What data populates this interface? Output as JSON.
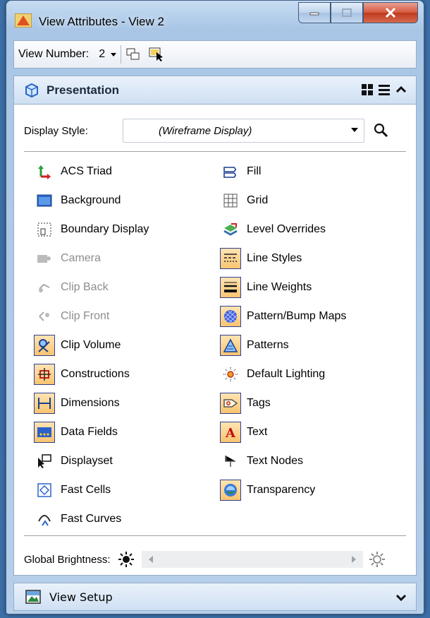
{
  "window": {
    "title": "View Attributes - View 2"
  },
  "toolbar": {
    "view_number_label": "View Number:",
    "view_number_value": "2"
  },
  "presentation": {
    "title": "Presentation",
    "display_style_label": "Display Style:",
    "display_style_value": "(Wireframe Display)",
    "left_items": [
      {
        "label": "ACS Triad",
        "icon": "acs-triad-icon",
        "on": false,
        "disabled": false
      },
      {
        "label": "Background",
        "icon": "background-icon",
        "on": false,
        "disabled": false
      },
      {
        "label": "Boundary Display",
        "icon": "boundary-display-icon",
        "on": false,
        "disabled": false
      },
      {
        "label": "Camera",
        "icon": "camera-icon",
        "on": false,
        "disabled": true
      },
      {
        "label": "Clip Back",
        "icon": "clip-back-icon",
        "on": false,
        "disabled": true
      },
      {
        "label": "Clip Front",
        "icon": "clip-front-icon",
        "on": false,
        "disabled": true
      },
      {
        "label": "Clip Volume",
        "icon": "clip-volume-icon",
        "on": true,
        "disabled": false
      },
      {
        "label": "Constructions",
        "icon": "constructions-icon",
        "on": true,
        "disabled": false
      },
      {
        "label": "Dimensions",
        "icon": "dimensions-icon",
        "on": true,
        "disabled": false
      },
      {
        "label": "Data Fields",
        "icon": "data-fields-icon",
        "on": true,
        "disabled": false
      },
      {
        "label": "Displayset",
        "icon": "displayset-icon",
        "on": false,
        "disabled": false
      },
      {
        "label": "Fast Cells",
        "icon": "fast-cells-icon",
        "on": false,
        "disabled": false
      },
      {
        "label": "Fast Curves",
        "icon": "fast-curves-icon",
        "on": false,
        "disabled": false
      }
    ],
    "right_items": [
      {
        "label": "Fill",
        "icon": "fill-icon",
        "on": false,
        "disabled": false
      },
      {
        "label": "Grid",
        "icon": "grid-icon",
        "on": false,
        "disabled": false
      },
      {
        "label": "Level Overrides",
        "icon": "level-overrides-icon",
        "on": false,
        "disabled": false
      },
      {
        "label": "Line Styles",
        "icon": "line-styles-icon",
        "on": true,
        "disabled": false
      },
      {
        "label": "Line Weights",
        "icon": "line-weights-icon",
        "on": true,
        "disabled": false
      },
      {
        "label": "Pattern/Bump Maps",
        "icon": "pattern-bump-maps-icon",
        "on": true,
        "disabled": false
      },
      {
        "label": "Patterns",
        "icon": "patterns-icon",
        "on": true,
        "disabled": false
      },
      {
        "label": "Default Lighting",
        "icon": "default-lighting-icon",
        "on": false,
        "disabled": false
      },
      {
        "label": "Tags",
        "icon": "tags-icon",
        "on": true,
        "disabled": false
      },
      {
        "label": "Text",
        "icon": "text-icon",
        "on": true,
        "disabled": false
      },
      {
        "label": "Text Nodes",
        "icon": "text-nodes-icon",
        "on": false,
        "disabled": false
      },
      {
        "label": "Transparency",
        "icon": "transparency-icon",
        "on": true,
        "disabled": false
      }
    ],
    "global_brightness_label": "Global Brightness:"
  },
  "view_setup": {
    "title": "View Setup"
  }
}
